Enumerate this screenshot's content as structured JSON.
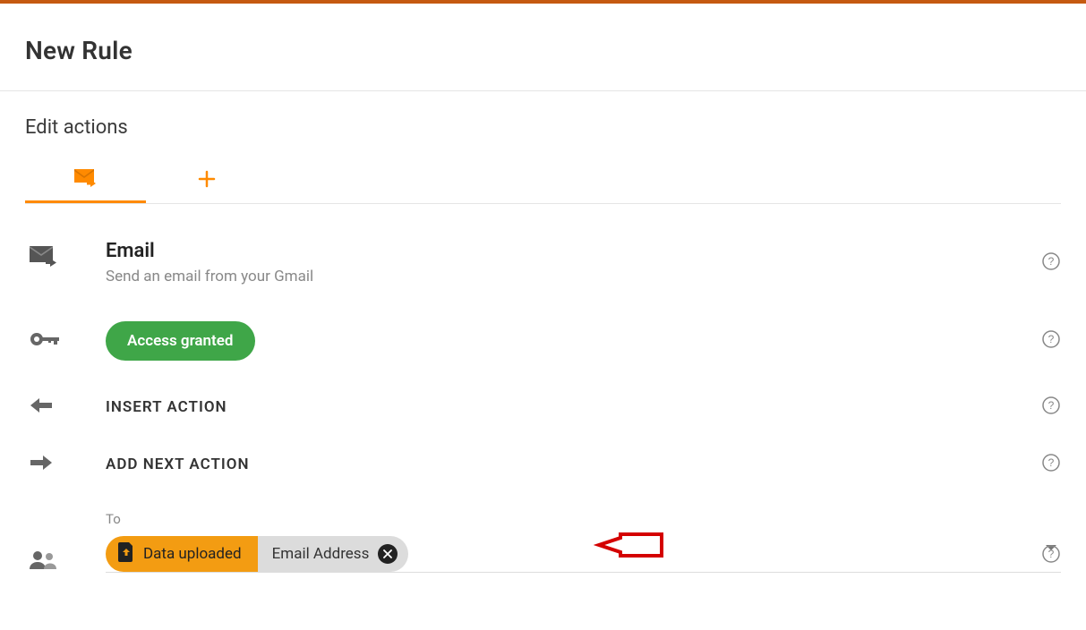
{
  "header": {
    "title": "New Rule"
  },
  "section": {
    "title": "Edit actions"
  },
  "action": {
    "title": "Email",
    "subtitle": "Send an email from your Gmail"
  },
  "access": {
    "label": "Access granted"
  },
  "insert": {
    "label": "INSERT ACTION"
  },
  "next": {
    "label": "ADD NEXT ACTION"
  },
  "to": {
    "label": "To",
    "chip_source": "Data uploaded",
    "chip_field": "Email Address"
  },
  "colors": {
    "accent": "#ff8a00",
    "green": "#3fa648",
    "chip_orange": "#f39c12"
  }
}
